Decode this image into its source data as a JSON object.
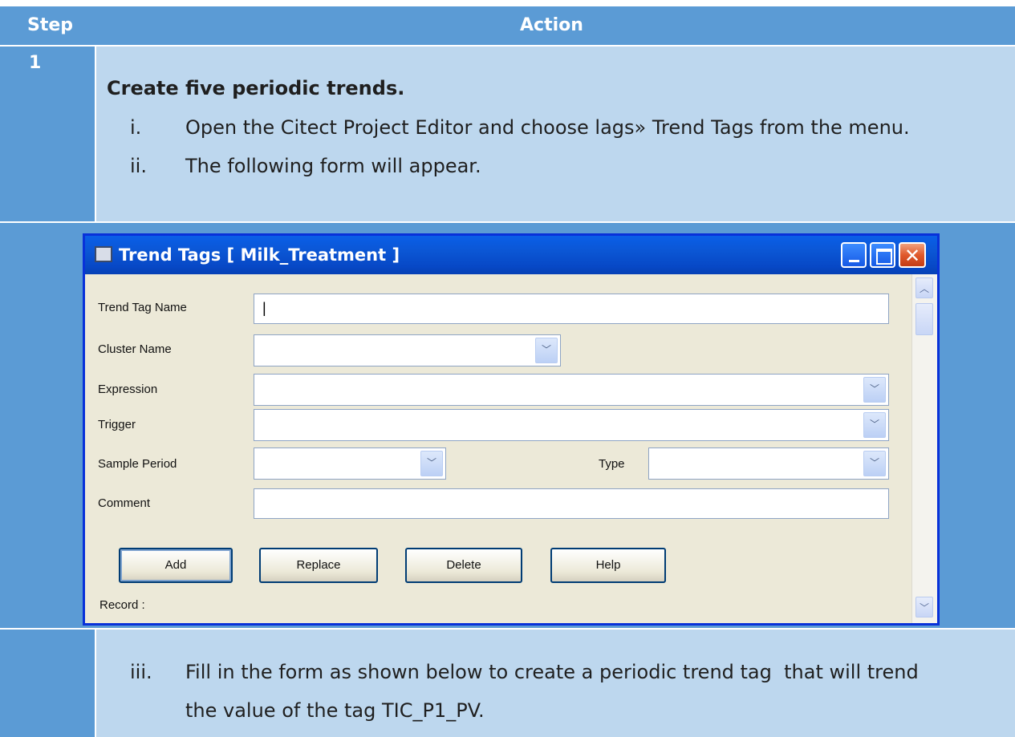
{
  "table": {
    "header": {
      "step": "Step",
      "action": "Action"
    },
    "step_number": "1",
    "heading": "Create five periodic trends.",
    "items": [
      {
        "numeral": "i.",
        "text": "Open the Citect Project Editor and choose lags» Trend Tags from the menu."
      },
      {
        "numeral": "ii.",
        "text": "The following form will appear."
      }
    ],
    "footer_item": {
      "numeral": "iii.",
      "line1": "Fill in the form as shown below to create a periodic trend tag  that will trend",
      "line2": "the value of the tag TIC_P1_PV."
    }
  },
  "dialog": {
    "title": "Trend Tags [ Milk_Treatment ]",
    "fields": {
      "trend_tag_name": {
        "label": "Trend Tag Name",
        "value": "|"
      },
      "cluster_name": {
        "label": "Cluster Name",
        "value": ""
      },
      "expression": {
        "label": "Expression",
        "value": ""
      },
      "trigger": {
        "label": "Trigger",
        "value": ""
      },
      "sample_period": {
        "label": "Sample Period",
        "value": ""
      },
      "type": {
        "label": "Type",
        "value": ""
      },
      "comment": {
        "label": "Comment",
        "value": ""
      }
    },
    "buttons": {
      "add": "Add",
      "replace": "Replace",
      "delete": "Delete",
      "help": "Help"
    },
    "record_label": "Record :",
    "colors": {
      "title_bar": "#0b56d4",
      "frame": "#0831d9",
      "body": "#ece9d8",
      "close": "#e0592c"
    }
  },
  "colors": {
    "header": "#5b9bd5",
    "row_light": "#bdd7ee"
  }
}
